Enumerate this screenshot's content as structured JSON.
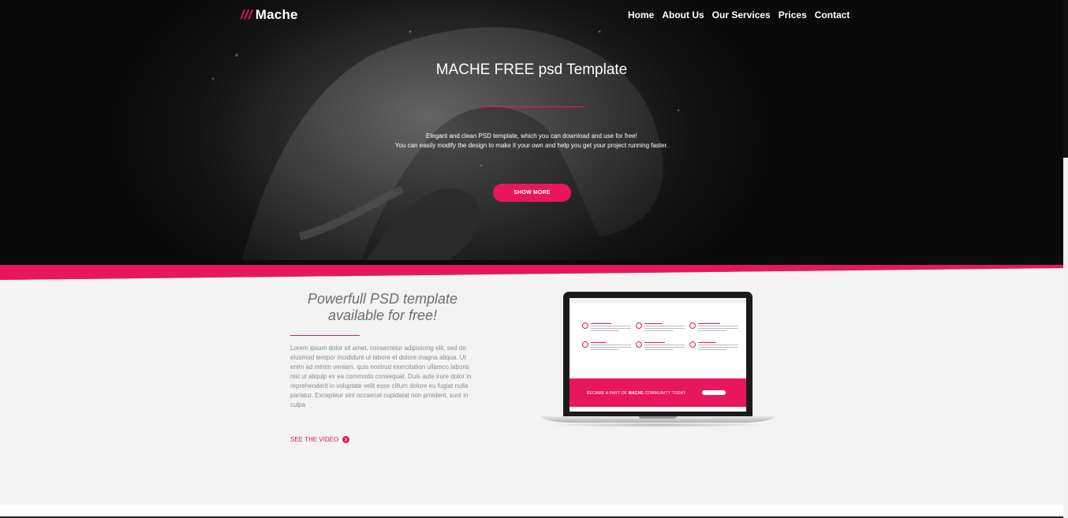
{
  "header": {
    "logo_slashes": "///",
    "logo_text": "Mache",
    "nav": [
      "Home",
      "About Us",
      "Our Services",
      "Prices",
      "Contact"
    ]
  },
  "hero": {
    "title": "MACHE FREE psd Template",
    "desc_line1": "Elegant and clean PSD template, which you can download and use for free!",
    "desc_line2": "You can easily modify the design to make it your own and help you get your project running faster.",
    "button": "SHOW MORE"
  },
  "feature": {
    "title_line1": "Powerfull PSD template",
    "title_line2": "available for free!",
    "body": "Lorem ipsum dolor sit amet, consectetur adipisicing elit, sed do eiusmod tempor incididunt ut labore et dolore magna aliqua. Ut enim ad minim veniam, quis nostrud exercitation ullamco laboris nisi ut aliquip ex ea commodo consequat. Duis aute irure dolor in reprehenderit in voluptate velit esse cillum dolore eu fugiat nulla pariatur. Excepteur sint occaecat cupidatat non proident, sunt in culpa",
    "link": "SEE THE VIDEO"
  },
  "laptop_screen": {
    "cta_prefix": "BECAME A PART OF",
    "cta_brand": "MACHE",
    "cta_suffix": "COMMUNITY TODAY"
  },
  "colors": {
    "accent": "#e8175d",
    "hero_bg": "#0a0a0a",
    "section_bg": "#f3f3f3"
  }
}
